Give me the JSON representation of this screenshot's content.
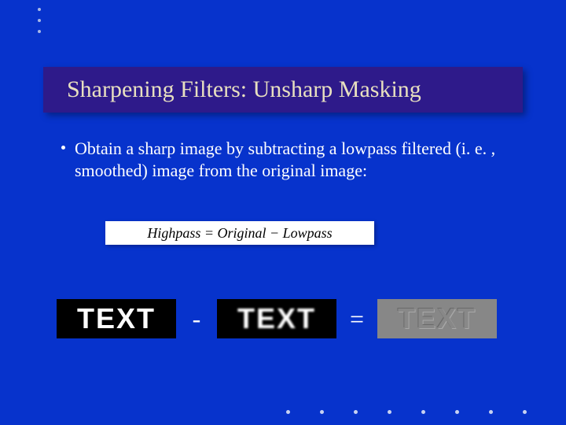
{
  "title": "Sharpening Filters: Unsharp Masking",
  "bullet": "Obtain a sharp image by subtracting a lowpass filtered (i. e. , smoothed) image from the original image:",
  "formula": "Highpass = Original − Lowpass",
  "text_blocks": {
    "sharp": "TEXT",
    "blur": "TEXT",
    "result": "TEXT"
  },
  "operators": {
    "minus": "-",
    "equals": "="
  }
}
